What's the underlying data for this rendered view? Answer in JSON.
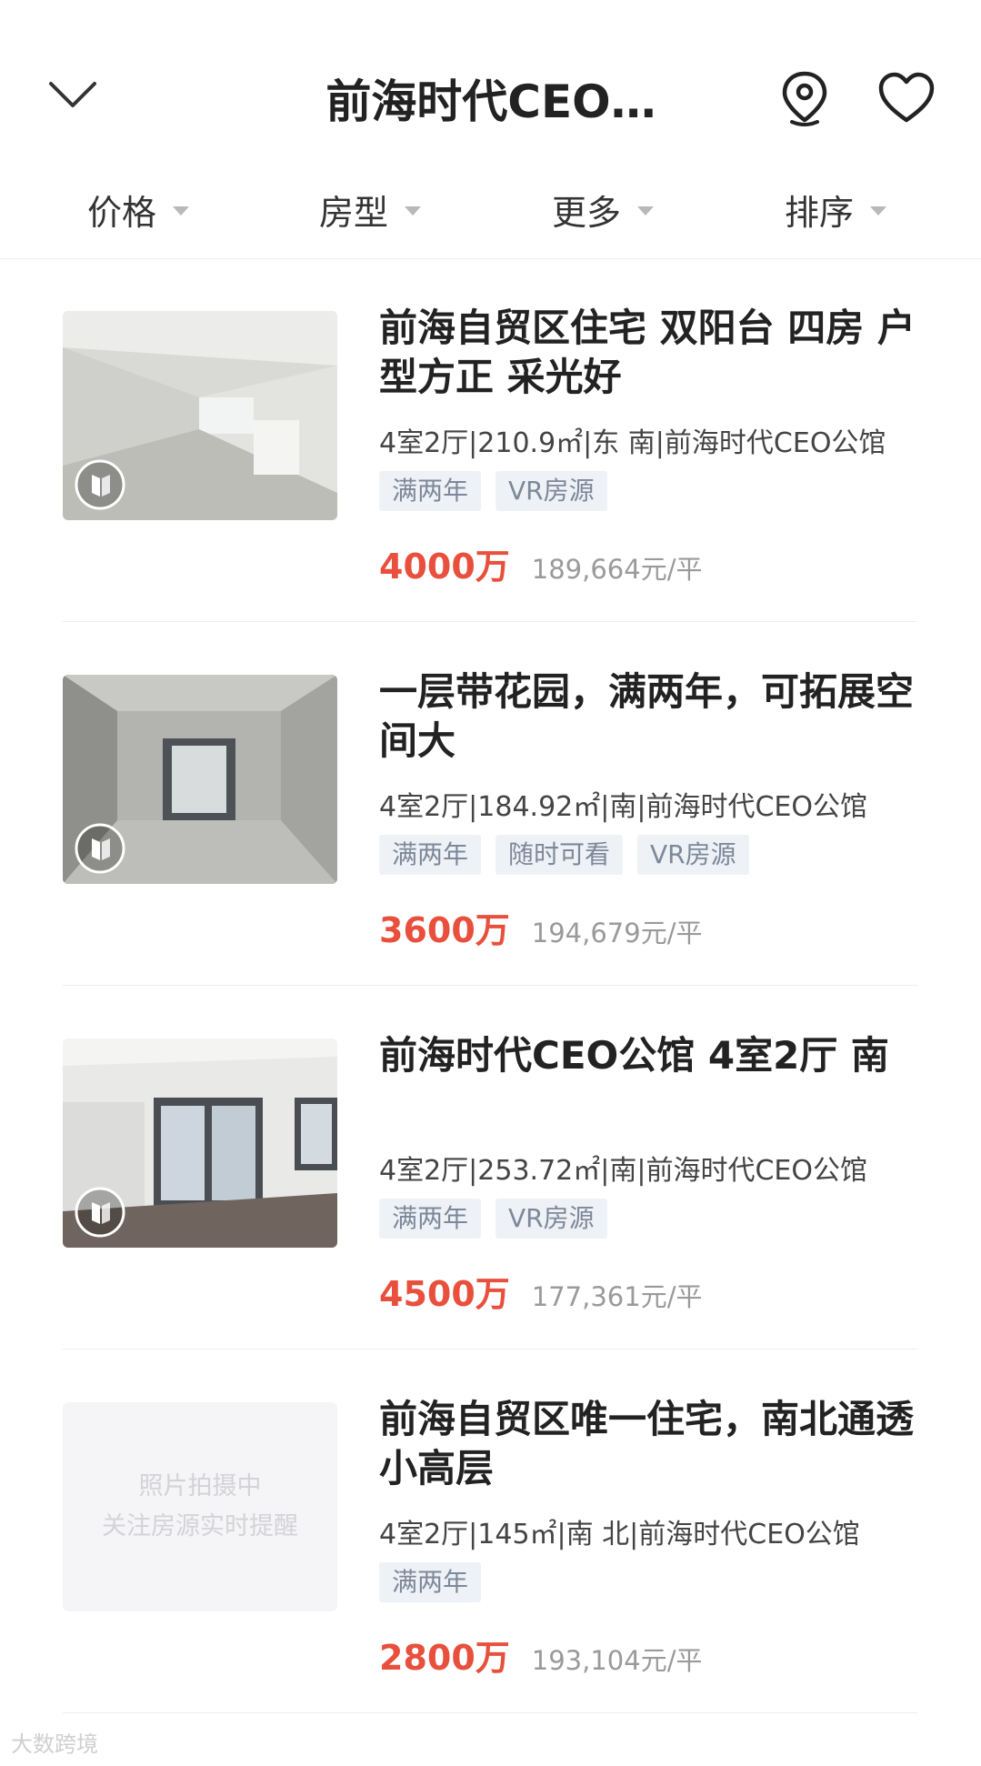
{
  "header": {
    "title": "前海时代CEO…",
    "back_icon": "chevron-down-icon",
    "location_icon": "location-pin-icon",
    "favorite_icon": "heart-icon"
  },
  "filters": [
    {
      "label": "价格"
    },
    {
      "label": "房型"
    },
    {
      "label": "更多"
    },
    {
      "label": "排序"
    }
  ],
  "listings": [
    {
      "title": "前海自贸区住宅 双阳台 四房 户型方正 采光好",
      "info": "4室2厅|210.9㎡|东 南|前海时代CEO公馆",
      "tags": [
        "满两年",
        "VR房源"
      ],
      "price": "4000万",
      "unit_price": "189,664元/平"
    },
    {
      "title": "一层带花园，满两年，可拓展空间大",
      "info": "4室2厅|184.92㎡|南|前海时代CEO公馆",
      "tags": [
        "满两年",
        "随时可看",
        "VR房源"
      ],
      "price": "3600万",
      "unit_price": "194,679元/平"
    },
    {
      "title": "前海时代CEO公馆 4室2厅 南",
      "info": "4室2厅|253.72㎡|南|前海时代CEO公馆",
      "tags": [
        "满两年",
        "VR房源"
      ],
      "price": "4500万",
      "unit_price": "177,361元/平"
    },
    {
      "title": "前海自贸区唯一住宅，南北通透小高层",
      "info": "4室2厅|145㎡|南 北|前海时代CEO公馆",
      "tags": [
        "满两年"
      ],
      "price": "2800万",
      "unit_price": "193,104元/平",
      "photo_placeholder": [
        "照片拍摄中",
        "关注房源实时提醒"
      ]
    }
  ],
  "watermark": "大数跨境",
  "colors": {
    "price": "#e8503d",
    "tag_bg": "#eef2f7",
    "tag_text": "#7d8899"
  }
}
